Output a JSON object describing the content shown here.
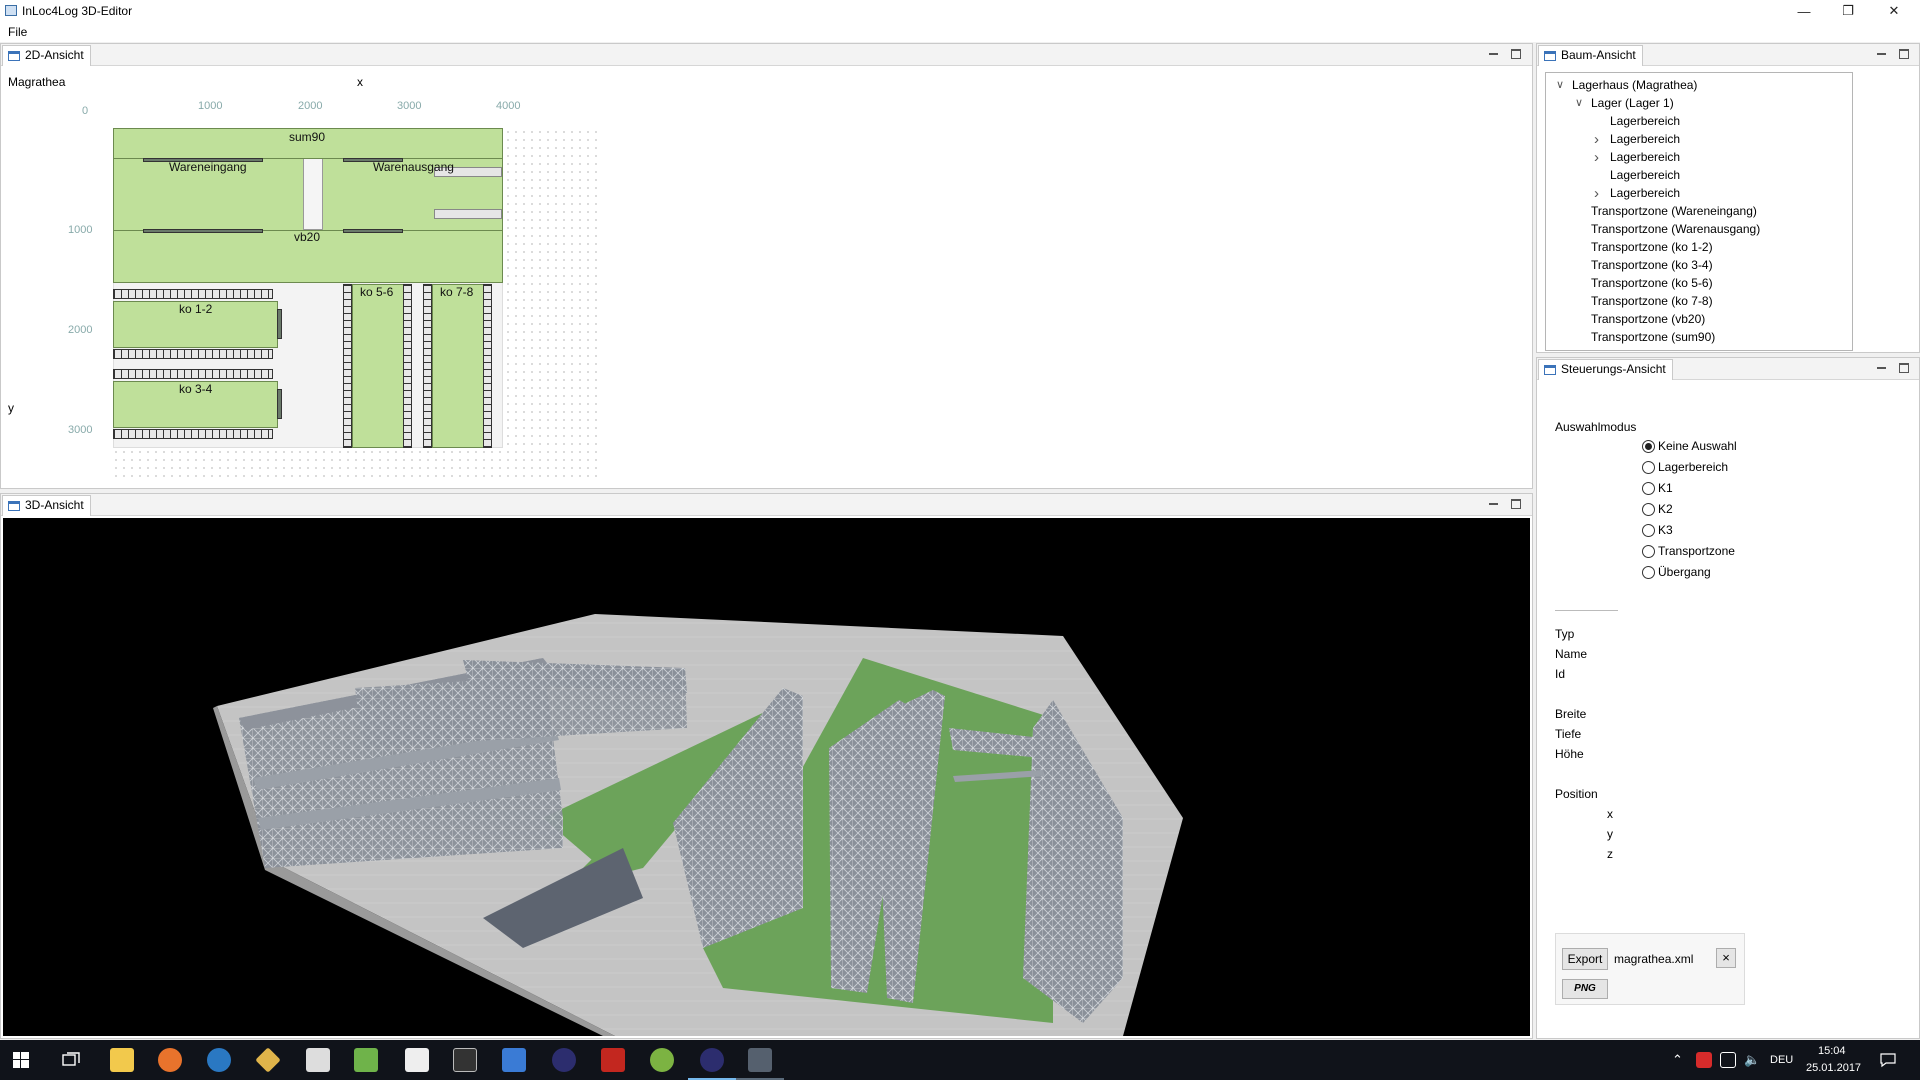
{
  "window": {
    "title": "InLoc4Log 3D-Editor"
  },
  "menu": {
    "file": "File"
  },
  "view2d": {
    "tab": "2D-Ansicht",
    "warehouse_name": "Magrathea",
    "x_axis_label": "x",
    "y_axis_label": "y",
    "x_ticks": [
      "0",
      "1000",
      "2000",
      "3000",
      "4000"
    ],
    "y_ticks": [
      "1000",
      "2000",
      "3000"
    ],
    "zones": {
      "sum90": "sum90",
      "wareneingang": "Wareneingang",
      "warenausgang": "Warenausgang",
      "vb20": "vb20",
      "ko12": "ko 1-2",
      "ko34": "ko 3-4",
      "ko56": "ko 5-6",
      "ko78": "ko 7-8"
    }
  },
  "view3d": {
    "tab": "3D-Ansicht"
  },
  "tree": {
    "tab": "Baum-Ansicht",
    "items": [
      {
        "label": "Lagerhaus (Magrathea)",
        "level": 0,
        "expander": "open"
      },
      {
        "label": "Lager (Lager 1)",
        "level": 1,
        "expander": "open"
      },
      {
        "label": "Lagerbereich",
        "level": 2,
        "expander": "none"
      },
      {
        "label": "Lagerbereich",
        "level": 2,
        "expander": "closed"
      },
      {
        "label": "Lagerbereich",
        "level": 2,
        "expander": "closed"
      },
      {
        "label": "Lagerbereich",
        "level": 2,
        "expander": "none"
      },
      {
        "label": "Lagerbereich",
        "level": 2,
        "expander": "closed"
      },
      {
        "label": "Transportzone (Wareneingang)",
        "level": 1,
        "expander": "none"
      },
      {
        "label": "Transportzone (Warenausgang)",
        "level": 1,
        "expander": "none"
      },
      {
        "label": "Transportzone (ko 1-2)",
        "level": 1,
        "expander": "none"
      },
      {
        "label": "Transportzone (ko 3-4)",
        "level": 1,
        "expander": "none"
      },
      {
        "label": "Transportzone (ko 5-6)",
        "level": 1,
        "expander": "none"
      },
      {
        "label": "Transportzone (ko 7-8)",
        "level": 1,
        "expander": "none"
      },
      {
        "label": "Transportzone (vb20)",
        "level": 1,
        "expander": "none"
      },
      {
        "label": "Transportzone (sum90)",
        "level": 1,
        "expander": "none"
      }
    ]
  },
  "control": {
    "tab": "Steuerungs-Ansicht",
    "mode_label": "Auswahlmodus",
    "modes": [
      {
        "label": "Keine Auswahl",
        "checked": true
      },
      {
        "label": "Lagerbereich",
        "checked": false
      },
      {
        "label": "K1",
        "checked": false
      },
      {
        "label": "K2",
        "checked": false
      },
      {
        "label": "K3",
        "checked": false
      },
      {
        "label": "Transportzone",
        "checked": false
      },
      {
        "label": "Übergang",
        "checked": false
      }
    ],
    "props": {
      "typ": "Typ",
      "name": "Name",
      "id": "Id",
      "breite": "Breite",
      "tiefe": "Tiefe",
      "hoehe": "Höhe",
      "position": "Position",
      "x": "x",
      "y": "y",
      "z": "z"
    },
    "export_button": "Export",
    "export_file": "magrathea.xml",
    "png_button": "PNG",
    "clear_button": "×"
  },
  "taskbar": {
    "language": "DEU",
    "time": "15:04",
    "date": "25.01.2017"
  }
}
